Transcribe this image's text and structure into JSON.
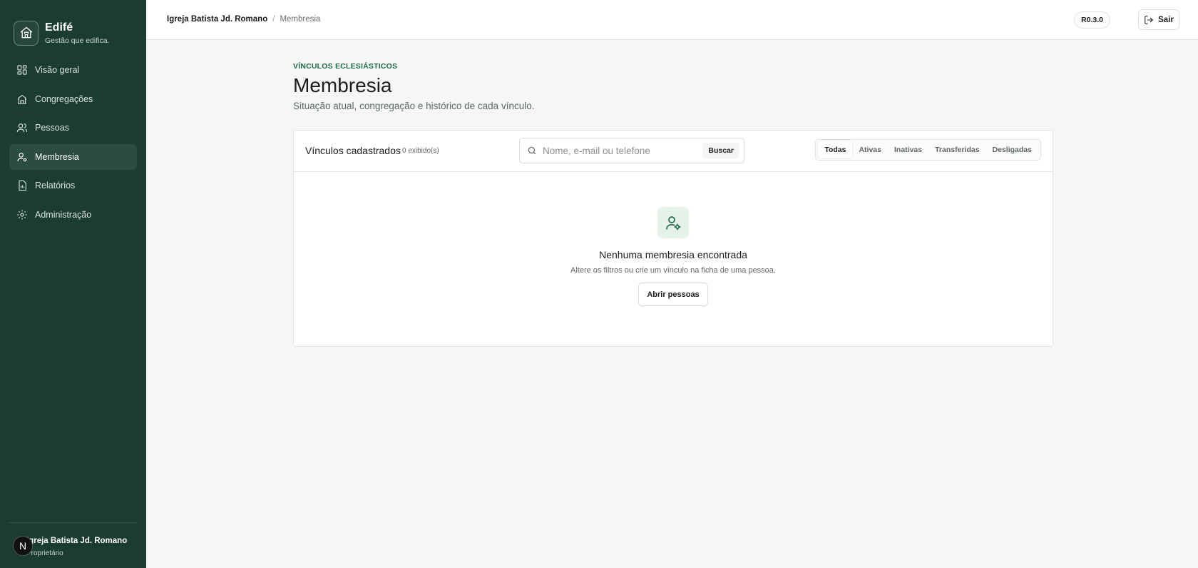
{
  "brand": {
    "name": "Edifé",
    "tagline": "Gestão que edifica."
  },
  "sidebar": {
    "items": [
      {
        "label": "Visão geral",
        "icon": "dashboard-icon",
        "active": false
      },
      {
        "label": "Congregações",
        "icon": "building-icon",
        "active": false
      },
      {
        "label": "Pessoas",
        "icon": "users-icon",
        "active": false
      },
      {
        "label": "Membresia",
        "icon": "user-cog-icon",
        "active": true
      },
      {
        "label": "Relatórios",
        "icon": "report-icon",
        "active": false
      },
      {
        "label": "Administração",
        "icon": "gear-icon",
        "active": false
      }
    ],
    "footer": {
      "avatar_initial": "N",
      "org_name": "Igreja Batista Jd. Romano",
      "role": "Proprietário"
    }
  },
  "header": {
    "breadcrumb": {
      "org": "Igreja Batista Jd. Romano",
      "separator": "/",
      "page": "Membresia"
    },
    "version": "R0.3.0",
    "logout_label": "Sair"
  },
  "main": {
    "eyebrow": "VÍNCULOS ECLESIÁSTICOS",
    "title": "Membresia",
    "subtitle": "Situação atual, congregação e histórico de cada vínculo.",
    "card": {
      "title": "Vínculos cadastrados",
      "count": "0 exibido(s)",
      "search": {
        "placeholder": "Nome, e-mail ou telefone",
        "value": "",
        "button": "Buscar"
      },
      "tabs": [
        "Todas",
        "Ativas",
        "Inativas",
        "Transferidas",
        "Desligadas"
      ],
      "active_tab": "Todas",
      "empty": {
        "title": "Nenhuma membresia encontrada",
        "description": "Altere os filtros ou crie um vínculo na ficha de uma pessoa.",
        "button": "Abrir pessoas"
      }
    }
  },
  "colors": {
    "sidebar": "#1a3c31",
    "accent": "#1f6b4a",
    "background": "#f5f7f5"
  }
}
